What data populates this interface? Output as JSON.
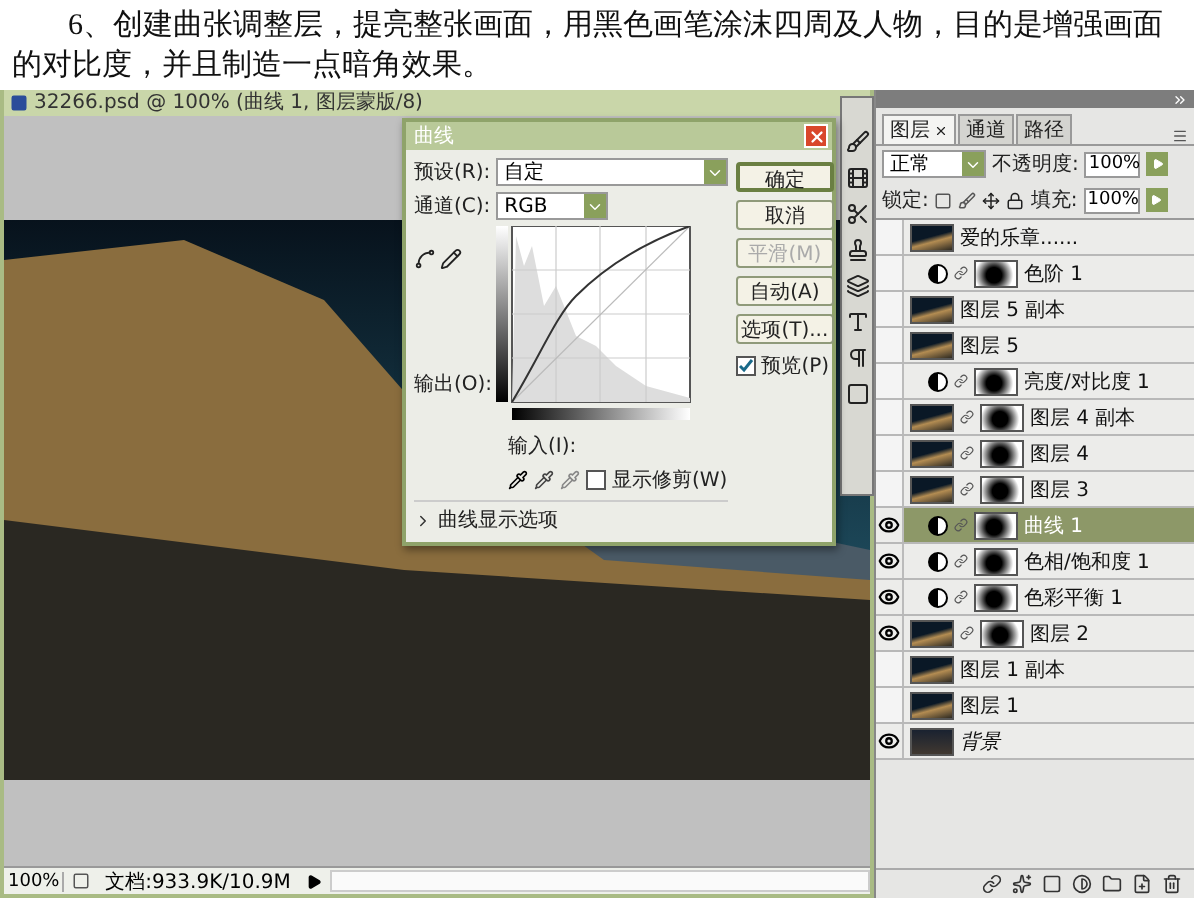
{
  "intro": {
    "text": "6、创建曲张调整层，提亮整张画面，用黑色画笔涂沫四周及人物，目的是增强画面的对比度，并且制造一点暗角效果。"
  },
  "document": {
    "title": "32266.psd @ 100% (曲线 1, 图层蒙版/8)",
    "zoom": "100%",
    "doc_info": "文档:933.9K/10.9M"
  },
  "curves_dialog": {
    "title": "曲线",
    "preset_label": "预设(R):",
    "preset": "自定",
    "channel_label": "通道(C):",
    "channel": "RGB",
    "output_label": "输出(O):",
    "input_label": "输入(I):",
    "buttons": [
      {
        "label": "确定",
        "disabled": false,
        "default": true
      },
      {
        "label": "取消",
        "disabled": false,
        "default": false
      },
      {
        "label": "平滑(M)",
        "disabled": true,
        "default": false
      },
      {
        "label": "自动(A)",
        "disabled": false,
        "default": false
      },
      {
        "label": "选项(T)...",
        "disabled": false,
        "default": false
      }
    ],
    "preview": {
      "label": "预览(P)",
      "checked": true
    },
    "show_clipping": {
      "label": "显示修剪(W)",
      "checked": false
    },
    "display_options": "曲线显示选项"
  },
  "layers_panel": {
    "tabs": [
      {
        "label": "图层",
        "selected": true
      },
      {
        "label": "通道",
        "selected": false
      },
      {
        "label": "路径",
        "selected": false
      }
    ],
    "blend_mode": "正常",
    "opacity_label": "不透明度:",
    "opacity": "100%",
    "lock_label": "锁定:",
    "fill_label": "填充:",
    "fill": "100%",
    "layers": [
      {
        "name": "爱的乐章......",
        "kind": "pixel",
        "mask": false,
        "visible": false,
        "selected": false
      },
      {
        "name": "色阶 1",
        "kind": "adjustment",
        "mask": true,
        "visible": false,
        "selected": false
      },
      {
        "name": "图层 5 副本",
        "kind": "pixel",
        "mask": false,
        "visible": false,
        "selected": false
      },
      {
        "name": "图层 5",
        "kind": "pixel",
        "mask": false,
        "visible": false,
        "selected": false
      },
      {
        "name": "亮度/对比度 1",
        "kind": "adjustment",
        "mask": true,
        "visible": false,
        "selected": false
      },
      {
        "name": "图层 4 副本",
        "kind": "pixel",
        "mask": true,
        "visible": false,
        "selected": false
      },
      {
        "name": "图层 4",
        "kind": "pixel",
        "mask": true,
        "visible": false,
        "selected": false
      },
      {
        "name": "图层 3",
        "kind": "pixel",
        "mask": true,
        "visible": false,
        "selected": false
      },
      {
        "name": "曲线 1",
        "kind": "adjustment",
        "mask": true,
        "visible": true,
        "selected": true
      },
      {
        "name": "色相/饱和度 1",
        "kind": "adjustment",
        "mask": true,
        "visible": true,
        "selected": false
      },
      {
        "name": "色彩平衡 1",
        "kind": "adjustment",
        "mask": true,
        "visible": true,
        "selected": false
      },
      {
        "name": "图层 2",
        "kind": "pixel",
        "mask": true,
        "visible": true,
        "selected": false
      },
      {
        "name": "图层 1 副本",
        "kind": "pixel",
        "mask": false,
        "visible": false,
        "selected": false
      },
      {
        "name": "图层 1",
        "kind": "pixel",
        "mask": false,
        "visible": false,
        "selected": false
      },
      {
        "name": "背景",
        "kind": "background",
        "mask": false,
        "visible": true,
        "selected": false
      }
    ]
  }
}
